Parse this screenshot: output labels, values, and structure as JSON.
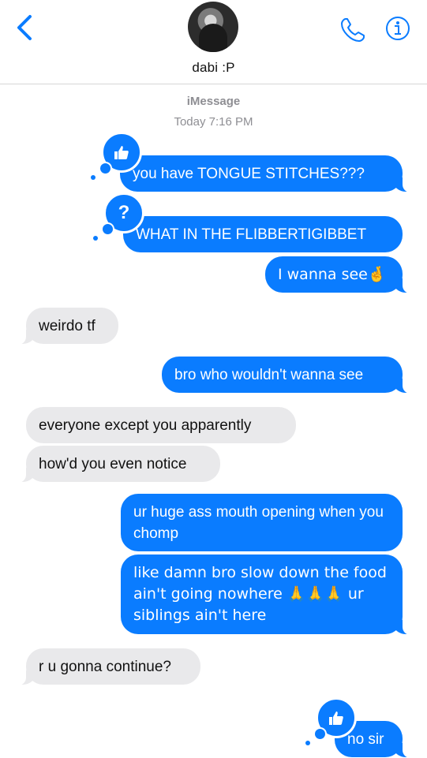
{
  "header": {
    "contact_name": "dabi :P",
    "back_icon": "chevron-left-icon",
    "call_icon": "phone-icon",
    "info_icon": "info-icon",
    "accent_color": "#0a7cff"
  },
  "thread_meta": {
    "service": "iMessage",
    "timestamp": "Today 7:16 PM"
  },
  "messages": [
    {
      "from": "me",
      "text": "you have TONGUE STITCHES???",
      "tapback": "thumbs-up"
    },
    {
      "from": "me",
      "text": "WHAT IN THE FLIBBERTIGIBBET",
      "tapback": "question"
    },
    {
      "from": "me",
      "text": "I wanna see🤞"
    },
    {
      "from": "them",
      "text": "weirdo tf"
    },
    {
      "from": "me",
      "text": "bro who wouldn't wanna see"
    },
    {
      "from": "them",
      "text": "everyone except you apparently"
    },
    {
      "from": "them",
      "text": "how'd you even notice"
    },
    {
      "from": "me",
      "text": "ur huge ass mouth opening when you chomp"
    },
    {
      "from": "me",
      "text": "like damn bro slow down the food ain't going nowhere 🙏🙏🙏 ur siblings ain't here"
    },
    {
      "from": "them",
      "text": "r u gonna continue?"
    },
    {
      "from": "me",
      "text": "no sir",
      "tapback": "thumbs-up"
    }
  ],
  "tapback_labels": {
    "question": "?"
  },
  "colors": {
    "sent_bubble": "#0a7cff",
    "received_bubble": "#e9e9eb",
    "meta_text": "#8e8e93"
  }
}
